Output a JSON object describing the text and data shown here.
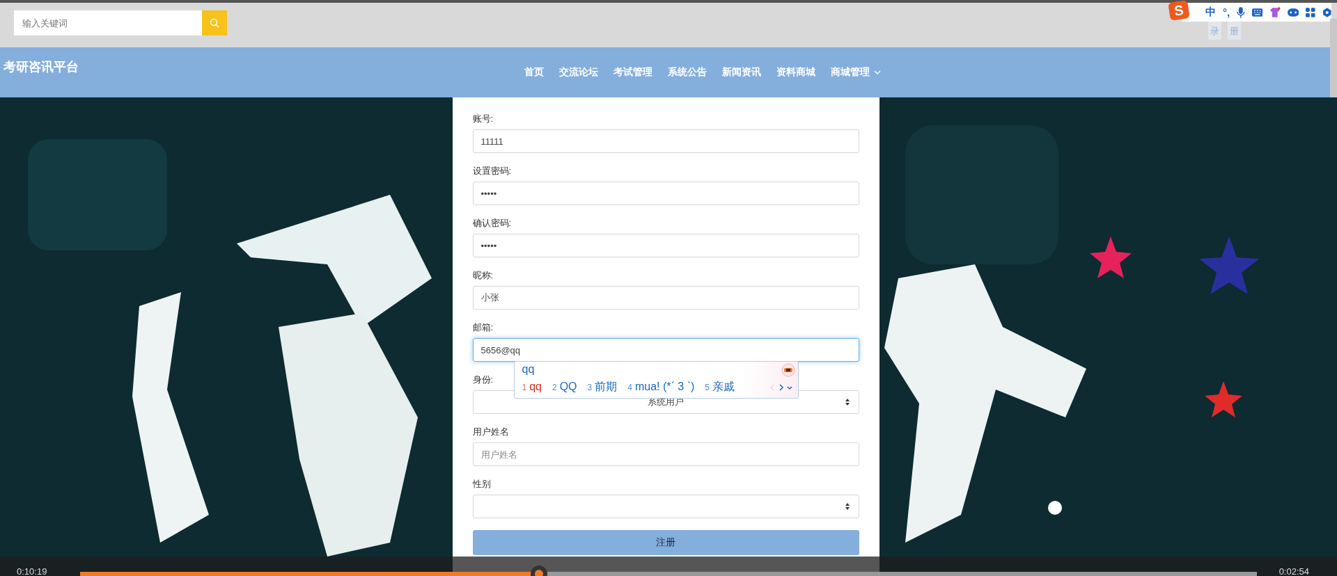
{
  "search": {
    "placeholder": "输入关键词"
  },
  "auth_buttons": [
    {
      "label": "录"
    },
    {
      "label": "册"
    }
  ],
  "ime_toolbar": {
    "logo": "S",
    "mode": "中",
    "punctuation": "°,"
  },
  "site_title": "考研咨讯平台",
  "nav": [
    {
      "label": "首页",
      "dropdown": false
    },
    {
      "label": "交流论坛",
      "dropdown": false
    },
    {
      "label": "考试管理",
      "dropdown": false
    },
    {
      "label": "系统公告",
      "dropdown": false
    },
    {
      "label": "新闻资讯",
      "dropdown": false
    },
    {
      "label": "资料商城",
      "dropdown": false
    },
    {
      "label": "商城管理",
      "dropdown": true
    }
  ],
  "form": {
    "fields": [
      {
        "kind": "text",
        "label": "账号:",
        "value": "11111",
        "focused": false
      },
      {
        "kind": "text",
        "label": "设置密码:",
        "value": "•••••",
        "focused": false
      },
      {
        "kind": "text",
        "label": "确认密码:",
        "value": "•••••",
        "focused": false
      },
      {
        "kind": "text",
        "label": "昵称:",
        "value": "小张",
        "focused": false
      },
      {
        "kind": "text",
        "label": "邮箱:",
        "value": "5656@qq",
        "focused": true
      },
      {
        "kind": "select",
        "label": "身份:",
        "value": "系统用户",
        "focused": false
      },
      {
        "kind": "text",
        "label": "用户姓名",
        "placeholder": "用户姓名",
        "focused": false
      },
      {
        "kind": "select",
        "label": "性别",
        "focused": false
      }
    ],
    "submit": "注册"
  },
  "ime_popup": {
    "composition": "qq",
    "candidates": [
      {
        "number": "1",
        "text": "qq",
        "selected": true
      },
      {
        "number": "2",
        "text": "QQ",
        "selected": false
      },
      {
        "number": "3",
        "text": "前期",
        "selected": false
      },
      {
        "number": "4",
        "text": "mua! (*ˊ 3 ˋ)",
        "selected": false
      },
      {
        "number": "5",
        "text": "亲戚",
        "selected": false
      }
    ]
  },
  "player": {
    "elapsed": "0:10:19",
    "remaining": "0:02:54",
    "level": 0.39
  }
}
